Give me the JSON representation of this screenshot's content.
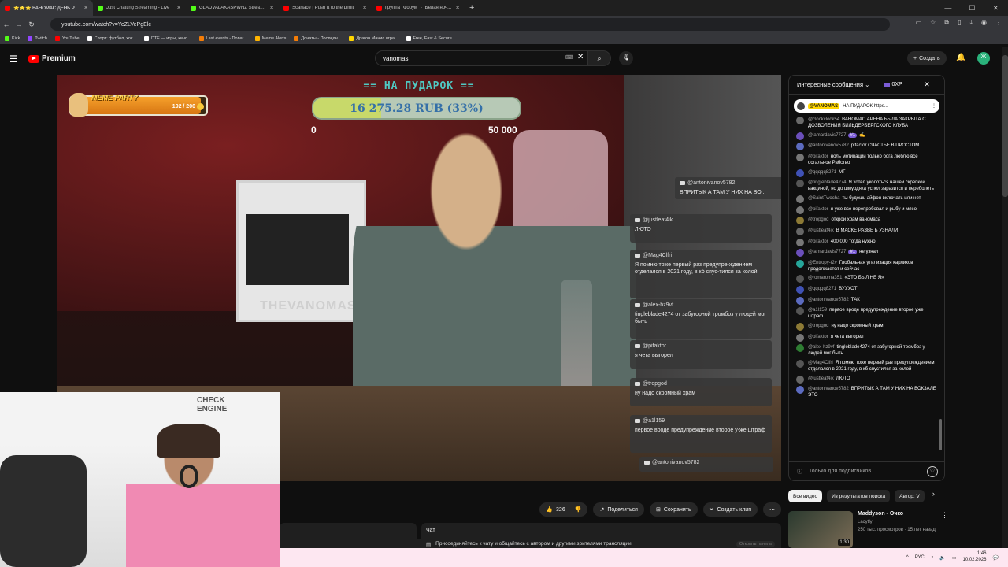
{
  "browser": {
    "tabs": [
      {
        "title": "⭐⭐⭐ ВАНОМАС ДЕНЬ РО...",
        "color": "#ff0000",
        "active": true
      },
      {
        "title": "Just Chatting Streaming - Live",
        "color": "#53fc18",
        "active": false
      },
      {
        "title": "GLADVALAKASPWNZ Stream -",
        "color": "#53fc18",
        "active": false
      },
      {
        "title": "Scarface | Push It to the Limit",
        "color": "#ff0000",
        "active": false
      },
      {
        "title": "Группа \"Форум\" - \"Белая ноч...",
        "color": "#ff0000",
        "active": false
      }
    ],
    "url": "youtube.com/watch?v=YeZLVePgElc",
    "bookmarks": [
      {
        "label": "Kick",
        "color": "#53fc18"
      },
      {
        "label": "Twitch",
        "color": "#9146ff"
      },
      {
        "label": "YouTube",
        "color": "#ff0000"
      },
      {
        "label": "Спорт: футбол, хок...",
        "color": "#ffffff"
      },
      {
        "label": "DTF — игры, кино...",
        "color": "#ffffff"
      },
      {
        "label": "Last events - Donat...",
        "color": "#f57d07"
      },
      {
        "label": "Meme Alerts",
        "color": "#ffb400"
      },
      {
        "label": "Донаты - Последн...",
        "color": "#f57d07"
      },
      {
        "label": "Драгон Манис игра...",
        "color": "#ffd600"
      },
      {
        "label": "Free, Fast & Secure...",
        "color": "#ffffff"
      }
    ]
  },
  "youtube": {
    "logo": "Premium",
    "search_value": "vanomas",
    "create_label": "Создать",
    "avatar_letter": "Ж"
  },
  "overlay": {
    "goal_title": "== НА ПУДАРОК ==",
    "goal_text": "16 275.28 RUB (33%)",
    "goal_fraction": 0.33,
    "goal_min": "0",
    "goal_max": "50 000",
    "meme_label": "MEME PARTY",
    "meme_count": "192 / 200",
    "meme_fraction": 0.96,
    "room_text": "THEVANOMAS",
    "sign_text": "CHECK ENGINE",
    "chat_overlay": [
      {
        "author": "@antonivanov5782",
        "text": "ВПРИТЫК А ТАМ У НИХ НА ВО..."
      },
      {
        "author": "@justleaf4ik",
        "text": "ЛЮТО"
      },
      {
        "author": "@Mag4Clfri",
        "text": "Я помню тоже первый раз предупре-ждением отделался в 2021 году, в кб спус-тился за колой"
      },
      {
        "author": "@alex-hz9vf",
        "text": "tingleblade4274 от забугорной тромбоз у людей мог быть"
      },
      {
        "author": "@pifaktor",
        "text": "я чета выгорел"
      },
      {
        "author": "@tropgod",
        "text": "ну надо скромный храм"
      },
      {
        "author": "@a1l159",
        "text": "первое вроде предупреждение второе у-же штраф"
      },
      {
        "author": "@antonivanov5782",
        "text": ""
      }
    ]
  },
  "actions": {
    "likes": "326",
    "share": "Поделиться",
    "save": "Сохранить",
    "clip": "Создать клип",
    "chat_title": "Чат",
    "join_text": "Присоединяйтесь к чату и общайтесь с автором и другими зрителями трансляции.",
    "open_label": "Открыть панель"
  },
  "chat": {
    "header": "Интересные сообщения",
    "xp": "0XP",
    "pinned_author": "@VANOMAS",
    "pinned_text": "НА ПУДАРОК https...",
    "messages": [
      {
        "author": "@clockclock54",
        "text": "ВАНОМАС АРЕНА БЫЛА ЗАКРЫТА С ДОЗВОЛЕНИЯ БИЛЬДЕРБЕРГСКОГО КЛУБА",
        "color": "#6a6a6a"
      },
      {
        "author": "@lamardavis7727",
        "badge": "#1",
        "text": "✍️",
        "color": "#6b4fbb"
      },
      {
        "author": "@antonivanov5782",
        "text": "pifactor СЧАСТЬЕ В ПРОСТОМ",
        "color": "#5c6bc0"
      },
      {
        "author": "@pifaktor",
        "text": "ноль мотивации только бога люблю все остальное Рабство",
        "color": "#777"
      },
      {
        "author": "@qqqqq8271",
        "text": "МГ",
        "color": "#3f51b5"
      },
      {
        "author": "@tingleblade4274",
        "text": "Я хотел уколоться нашей скрепкой вакциной, но до шмурдяка успел заразится и переболеть",
        "color": "#555"
      },
      {
        "author": "@SaintTwocha",
        "text": "ты будешь айфон включать или нет",
        "color": "#777"
      },
      {
        "author": "@pifaktor",
        "text": "я уже все перепробовал и рыбу и мясо",
        "color": "#777"
      },
      {
        "author": "@tropgod",
        "text": "открой храм ваномаса",
        "color": "#8d7a35"
      },
      {
        "author": "@justleaf4ik",
        "text": "В МАСКЕ РАЗВЕ Б УЗНАЛИ",
        "color": "#666"
      },
      {
        "author": "@pifaktor",
        "text": "400.000 тогда нужно",
        "color": "#777"
      },
      {
        "author": "@lamardavis7727",
        "badge": "#1",
        "text": "не узнал",
        "color": "#6b4fbb"
      },
      {
        "author": "@Entropy-t2v",
        "text": "Глобальная утилизация карликов продолжается и сейчас",
        "color": "#26a69a"
      },
      {
        "author": "@romaroma351",
        "text": "«ЭТО БЫЛ НЕ Я»",
        "color": "#555"
      },
      {
        "author": "@qqqqq8271",
        "text": "ВУУУОТ",
        "color": "#3f51b5"
      },
      {
        "author": "@antonivanov5782",
        "text": "ТАК",
        "color": "#5c6bc0"
      },
      {
        "author": "@a1l159",
        "text": "первое вроде предупреждение второе уже штраф",
        "color": "#555"
      },
      {
        "author": "@tropgod",
        "text": "ну надо скромный храм",
        "color": "#8d7a35"
      },
      {
        "author": "@pifaktor",
        "text": "я чета выгорел",
        "color": "#777"
      },
      {
        "author": "@alex-hz9vf",
        "text": "tingleblade4274 от забугорной тромбоз у людей мог быть",
        "color": "#2e7d32"
      },
      {
        "author": "@Mag4Clfri",
        "text": "Я помню тоже первый раз предупреждением отделался в 2021 году, в кб спустился за колой",
        "color": "#555"
      },
      {
        "author": "@justleaf4ik",
        "text": "ЛЮТО",
        "color": "#666"
      },
      {
        "author": "@antonivanov5782",
        "text": "ВПРИТЫК А ТАМ У НИХ НА ВОКЗАЛЕ ЭТО",
        "color": "#5c6bc0"
      }
    ],
    "footer_text": "Только для подписчиков"
  },
  "recs": {
    "chips": [
      "Все видео",
      "Из результатов поиска",
      "Автор: V"
    ],
    "video": {
      "title": "Maddyson - Очко",
      "channel": "Lacytly",
      "meta": "250 тыс. просмотров · 15 лет назад",
      "duration": "1:30"
    }
  },
  "taskbar": {
    "lang": "РУС",
    "time": "1:46",
    "date": "10.02.2026"
  }
}
